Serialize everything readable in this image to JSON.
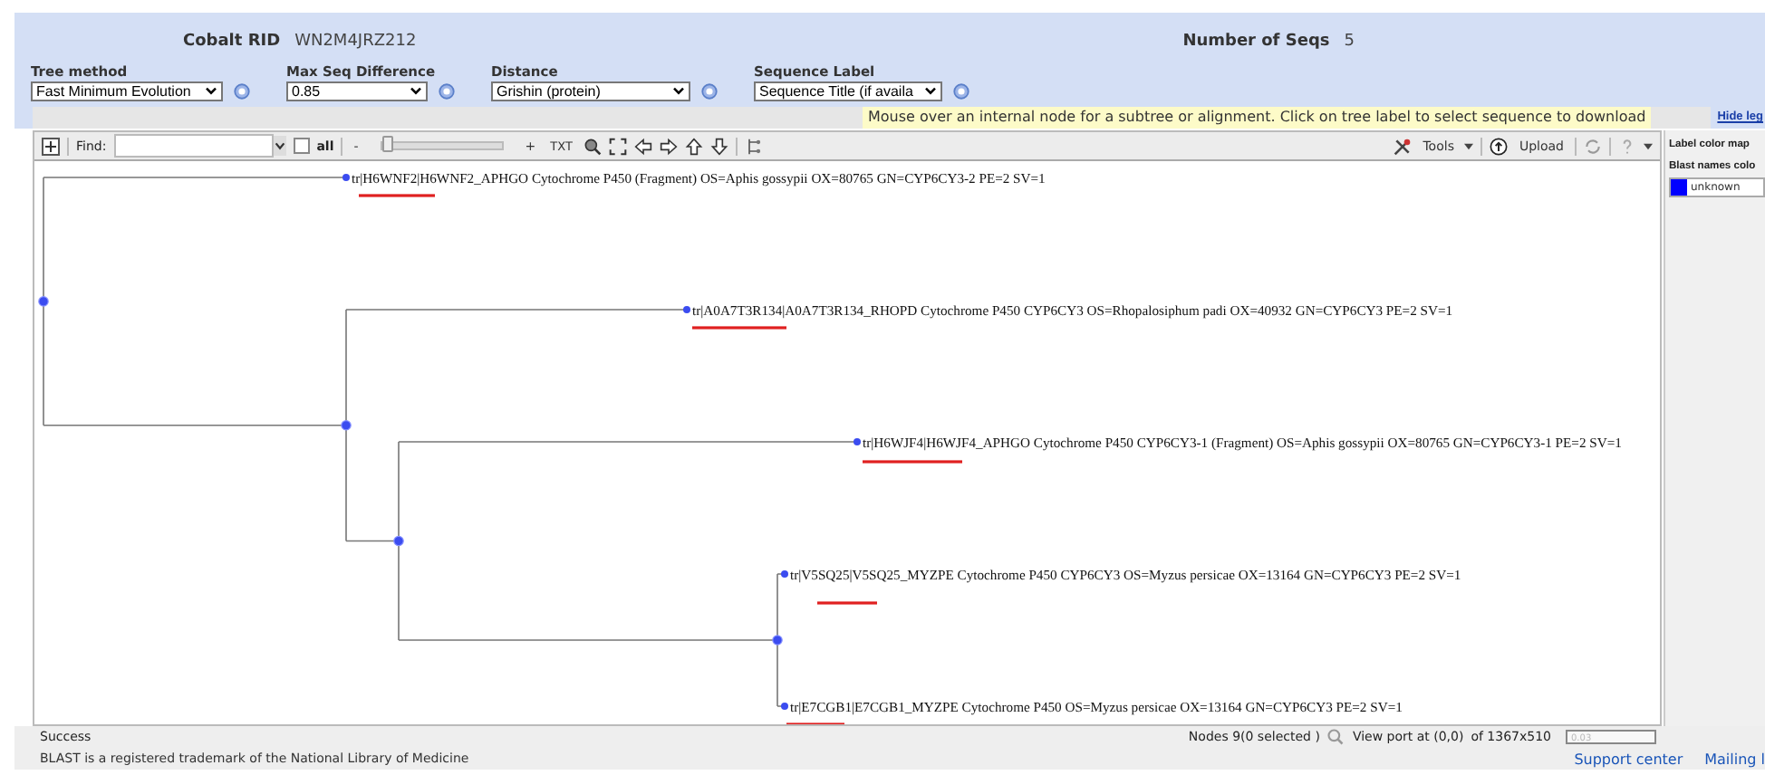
{
  "header": {
    "rid_label": "Cobalt RID",
    "rid": "WN2M4JRZ212",
    "seqs_label": "Number of Seqs",
    "seqs": "5"
  },
  "params": [
    {
      "label": "Tree method",
      "value": "Fast Minimum Evolution"
    },
    {
      "label": "Max Seq Difference",
      "value": "0.85"
    },
    {
      "label": "Distance",
      "value": "Grishin (protein)"
    },
    {
      "label": "Sequence Label",
      "value": "Sequence Title (if availa"
    }
  ],
  "hint": "Mouse over an internal node for a subtree or alignment. Click on tree label to select sequence to download",
  "hide_legend": "Hide leg",
  "toolbar": {
    "find_label": "Find:",
    "all_label": "all",
    "all_checked": false,
    "zoom_minus": "-",
    "zoom_plus": "+",
    "zoom": {
      "level": 0
    },
    "txt": "TXT",
    "tools": "Tools",
    "upload": "Upload"
  },
  "legend": {
    "title": "Label color map",
    "subtitle": "Blast names colo",
    "items": [
      {
        "label": "unknown",
        "color": "#0000ff"
      }
    ]
  },
  "tree": {
    "children": [
      {
        "label": "tr|H6WNF2|H6WNF2_APHGO Cytochrome P450 (Fragment) OS=Aphis gossypii OX=80765 GN=CYP6CY3-2 PE=2 SV=1",
        "underlined": true
      },
      {
        "children": [
          {
            "label": "tr|A0A7T3R134|A0A7T3R134_RHOPD Cytochrome P450 CYP6CY3 OS=Rhopalosiphum padi OX=40932 GN=CYP6CY3 PE=2 SV=1",
            "underlined": true
          },
          {
            "children": [
              {
                "label": "tr|H6WJF4|H6WJF4_APHGO Cytochrome P450 CYP6CY3-1 (Fragment) OS=Aphis gossypii OX=80765 GN=CYP6CY3-1 PE=2 SV=1",
                "underlined": true
              },
              {
                "children": [
                  {
                    "label": "tr|V5SQ25|V5SQ25_MYZPE Cytochrome P450 CYP6CY3 OS=Myzus persicae OX=13164 GN=CYP6CY3 PE=2 SV=1",
                    "underlined": true
                  },
                  {
                    "label": "tr|E7CGB1|E7CGB1_MYZPE Cytochrome P450 OS=Myzus persicae OX=13164 GN=CYP6CY3 PE=2 SV=1",
                    "underlined": true
                  }
                ]
              }
            ]
          }
        ]
      }
    ]
  },
  "status": {
    "message": "Success",
    "nodes": "Nodes 9(0 selected )",
    "viewport": "View port at (0,0)",
    "size": "of 1367x510",
    "scale": "0.03"
  },
  "footer": {
    "trademark": "BLAST is a registered trademark of the National Library of Medicine",
    "links": [
      "Support center",
      "Mailing l"
    ]
  }
}
